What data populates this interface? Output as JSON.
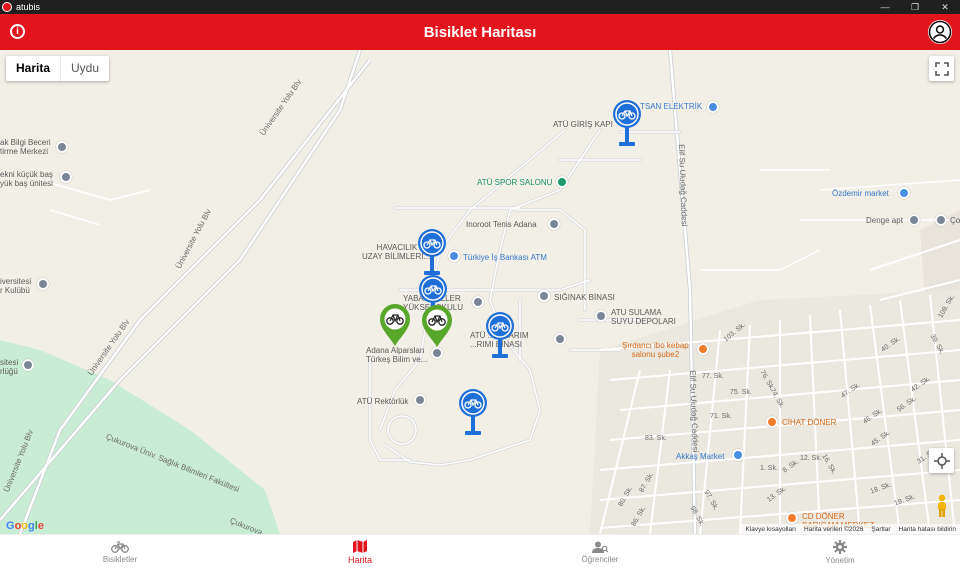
{
  "window": {
    "app_name": "atubis",
    "minimize": "—",
    "maximize": "❐",
    "close": "✕"
  },
  "header": {
    "title": "Bisiklet Haritası",
    "info_icon": "info-icon",
    "profile_icon": "account-circle-icon"
  },
  "map": {
    "map_types": [
      "Harita",
      "Uydu"
    ],
    "selected_map_type": "Harita",
    "labels": {
      "atu_giris": "ATÜ GİRİŞ KAPI",
      "tsan": "TSAN ELEKTRİK",
      "spor_salonu": "ATÜ SPOR SALONU",
      "tenis": "Inoroot Tenis Adana",
      "havacilik": "HAVACILIK VE\nUZAY BİLİMLERİ...",
      "is_bankasi": "Türkiye İş Bankası ATM",
      "yabanci": "YABA... DİLLER\nYÜKSEKOKULU",
      "siginak": "SIĞINAK BİNASI",
      "sulama": "ATU SULAMA\nSUYU DEPOLARI",
      "onarim": "ATÜ ... ONARIM\n...RIMI BİNASI",
      "alparslan": "Adana Alparslan\nTürkeş Bilim ve...",
      "rektorluk": "ATÜ Rektörlük",
      "sirdanci": "Şırdancı ibo kebap\nsalonu şube2",
      "cihat": "CİHAT DÖNER",
      "akkas": "Akkaş Market",
      "cd_doner": "CD DÖNER\nSARIÇAM MERKEZ",
      "ozdemir": "Özdemir market",
      "denge": "Denge apt",
      "bilgi_beceri": "ak Bilgi Beceri\ntirme Merkezi",
      "ekni": "ekni küçük baş\nyük baş ünitesi",
      "universite_kulubu": "iversitesi\nr Kulübü",
      "sitesi": "sitesi\nrlüğü",
      "univ_blv_1": "Üniversite Yolu Blv",
      "univ_blv_2": "Üniversite Yolu Blv",
      "univ_blv_3": "Üniversite Yolu Blv",
      "univ_blv_4": "Üniversite Yolu Blv",
      "elif_su_1": "Elif Su Uludağ Caddesi",
      "elif_su_2": "Elif Su Uludağ Caddesi",
      "cukurova": "Çukurova Üniv. Sağlık Bilimleri Fakültesi",
      "cukurova_2": "Çukurova",
      "codd": "Çod"
    },
    "street_labels": [
      "103. Sk.",
      "77. Sk.",
      "76. Sk.",
      "75. Sk.",
      "74. Sk.",
      "71. Sk.",
      "83. Sk.",
      "80. Sk.",
      "87. Sk.",
      "86. Sk.",
      "97. Sk.",
      "98. Sk.",
      "1. Sk.",
      "8. Sk.",
      "13. Sk.",
      "16. Sk.",
      "12. Sk.",
      "46. Sk.",
      "45. Sk.",
      "42. Sk.",
      "39. Sk.",
      "40. Sk.",
      "19. Sk.",
      "18. Sk.",
      "31. Sk.",
      "109. Sk.",
      "47. Sk.",
      "56. Sk."
    ],
    "google": "Google",
    "attribution": [
      "Klavye kısayolları",
      "Harita verileri ©2026",
      "Şartlar",
      "Harita hatası bildirin"
    ],
    "markers": [
      {
        "kind": "station",
        "color": "#1f6fd8"
      },
      {
        "kind": "station",
        "color": "#1f6fd8"
      },
      {
        "kind": "station",
        "color": "#1f6fd8"
      },
      {
        "kind": "station",
        "color": "#1f6fd8"
      },
      {
        "kind": "station",
        "color": "#1f6fd8"
      },
      {
        "kind": "bike",
        "color": "#58a62a"
      },
      {
        "kind": "bike",
        "color": "#58a62a"
      }
    ]
  },
  "nav": [
    {
      "label": "Bisikletler",
      "icon": "bicycle-icon",
      "active": false
    },
    {
      "label": "Harita",
      "icon": "map-icon",
      "active": true
    },
    {
      "label": "Öğrenciler",
      "icon": "students-icon",
      "active": false
    },
    {
      "label": "Yönetim",
      "icon": "settings-icon",
      "active": false
    }
  ]
}
